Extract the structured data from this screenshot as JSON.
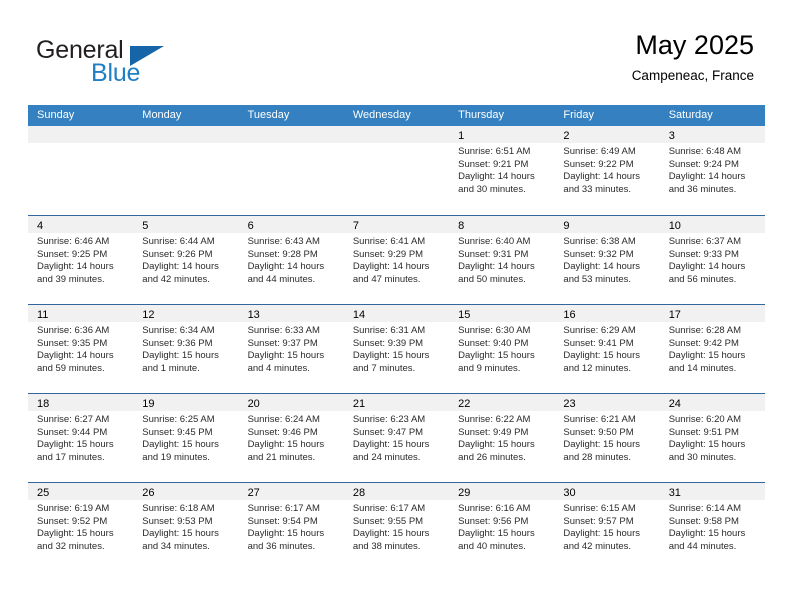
{
  "brand": {
    "name_part1": "General",
    "name_part2": "Blue",
    "accent_color": "#1f7fc4",
    "triangle_color": "#1565a8"
  },
  "header": {
    "title": "May 2025",
    "location": "Campeneac, France"
  },
  "table": {
    "header_bg": "#3480c0",
    "header_text_color": "#ffffff",
    "day_strip_bg": "#f1f1f1",
    "weekdays": [
      "Sunday",
      "Monday",
      "Tuesday",
      "Wednesday",
      "Thursday",
      "Friday",
      "Saturday"
    ]
  },
  "weeks": [
    [
      {
        "day": "",
        "lines": []
      },
      {
        "day": "",
        "lines": []
      },
      {
        "day": "",
        "lines": []
      },
      {
        "day": "",
        "lines": []
      },
      {
        "day": "1",
        "lines": [
          "Sunrise: 6:51 AM",
          "Sunset: 9:21 PM",
          "Daylight: 14 hours",
          "and 30 minutes."
        ]
      },
      {
        "day": "2",
        "lines": [
          "Sunrise: 6:49 AM",
          "Sunset: 9:22 PM",
          "Daylight: 14 hours",
          "and 33 minutes."
        ]
      },
      {
        "day": "3",
        "lines": [
          "Sunrise: 6:48 AM",
          "Sunset: 9:24 PM",
          "Daylight: 14 hours",
          "and 36 minutes."
        ]
      }
    ],
    [
      {
        "day": "4",
        "lines": [
          "Sunrise: 6:46 AM",
          "Sunset: 9:25 PM",
          "Daylight: 14 hours",
          "and 39 minutes."
        ]
      },
      {
        "day": "5",
        "lines": [
          "Sunrise: 6:44 AM",
          "Sunset: 9:26 PM",
          "Daylight: 14 hours",
          "and 42 minutes."
        ]
      },
      {
        "day": "6",
        "lines": [
          "Sunrise: 6:43 AM",
          "Sunset: 9:28 PM",
          "Daylight: 14 hours",
          "and 44 minutes."
        ]
      },
      {
        "day": "7",
        "lines": [
          "Sunrise: 6:41 AM",
          "Sunset: 9:29 PM",
          "Daylight: 14 hours",
          "and 47 minutes."
        ]
      },
      {
        "day": "8",
        "lines": [
          "Sunrise: 6:40 AM",
          "Sunset: 9:31 PM",
          "Daylight: 14 hours",
          "and 50 minutes."
        ]
      },
      {
        "day": "9",
        "lines": [
          "Sunrise: 6:38 AM",
          "Sunset: 9:32 PM",
          "Daylight: 14 hours",
          "and 53 minutes."
        ]
      },
      {
        "day": "10",
        "lines": [
          "Sunrise: 6:37 AM",
          "Sunset: 9:33 PM",
          "Daylight: 14 hours",
          "and 56 minutes."
        ]
      }
    ],
    [
      {
        "day": "11",
        "lines": [
          "Sunrise: 6:36 AM",
          "Sunset: 9:35 PM",
          "Daylight: 14 hours",
          "and 59 minutes."
        ]
      },
      {
        "day": "12",
        "lines": [
          "Sunrise: 6:34 AM",
          "Sunset: 9:36 PM",
          "Daylight: 15 hours",
          "and 1 minute."
        ]
      },
      {
        "day": "13",
        "lines": [
          "Sunrise: 6:33 AM",
          "Sunset: 9:37 PM",
          "Daylight: 15 hours",
          "and 4 minutes."
        ]
      },
      {
        "day": "14",
        "lines": [
          "Sunrise: 6:31 AM",
          "Sunset: 9:39 PM",
          "Daylight: 15 hours",
          "and 7 minutes."
        ]
      },
      {
        "day": "15",
        "lines": [
          "Sunrise: 6:30 AM",
          "Sunset: 9:40 PM",
          "Daylight: 15 hours",
          "and 9 minutes."
        ]
      },
      {
        "day": "16",
        "lines": [
          "Sunrise: 6:29 AM",
          "Sunset: 9:41 PM",
          "Daylight: 15 hours",
          "and 12 minutes."
        ]
      },
      {
        "day": "17",
        "lines": [
          "Sunrise: 6:28 AM",
          "Sunset: 9:42 PM",
          "Daylight: 15 hours",
          "and 14 minutes."
        ]
      }
    ],
    [
      {
        "day": "18",
        "lines": [
          "Sunrise: 6:27 AM",
          "Sunset: 9:44 PM",
          "Daylight: 15 hours",
          "and 17 minutes."
        ]
      },
      {
        "day": "19",
        "lines": [
          "Sunrise: 6:25 AM",
          "Sunset: 9:45 PM",
          "Daylight: 15 hours",
          "and 19 minutes."
        ]
      },
      {
        "day": "20",
        "lines": [
          "Sunrise: 6:24 AM",
          "Sunset: 9:46 PM",
          "Daylight: 15 hours",
          "and 21 minutes."
        ]
      },
      {
        "day": "21",
        "lines": [
          "Sunrise: 6:23 AM",
          "Sunset: 9:47 PM",
          "Daylight: 15 hours",
          "and 24 minutes."
        ]
      },
      {
        "day": "22",
        "lines": [
          "Sunrise: 6:22 AM",
          "Sunset: 9:49 PM",
          "Daylight: 15 hours",
          "and 26 minutes."
        ]
      },
      {
        "day": "23",
        "lines": [
          "Sunrise: 6:21 AM",
          "Sunset: 9:50 PM",
          "Daylight: 15 hours",
          "and 28 minutes."
        ]
      },
      {
        "day": "24",
        "lines": [
          "Sunrise: 6:20 AM",
          "Sunset: 9:51 PM",
          "Daylight: 15 hours",
          "and 30 minutes."
        ]
      }
    ],
    [
      {
        "day": "25",
        "lines": [
          "Sunrise: 6:19 AM",
          "Sunset: 9:52 PM",
          "Daylight: 15 hours",
          "and 32 minutes."
        ]
      },
      {
        "day": "26",
        "lines": [
          "Sunrise: 6:18 AM",
          "Sunset: 9:53 PM",
          "Daylight: 15 hours",
          "and 34 minutes."
        ]
      },
      {
        "day": "27",
        "lines": [
          "Sunrise: 6:17 AM",
          "Sunset: 9:54 PM",
          "Daylight: 15 hours",
          "and 36 minutes."
        ]
      },
      {
        "day": "28",
        "lines": [
          "Sunrise: 6:17 AM",
          "Sunset: 9:55 PM",
          "Daylight: 15 hours",
          "and 38 minutes."
        ]
      },
      {
        "day": "29",
        "lines": [
          "Sunrise: 6:16 AM",
          "Sunset: 9:56 PM",
          "Daylight: 15 hours",
          "and 40 minutes."
        ]
      },
      {
        "day": "30",
        "lines": [
          "Sunrise: 6:15 AM",
          "Sunset: 9:57 PM",
          "Daylight: 15 hours",
          "and 42 minutes."
        ]
      },
      {
        "day": "31",
        "lines": [
          "Sunrise: 6:14 AM",
          "Sunset: 9:58 PM",
          "Daylight: 15 hours",
          "and 44 minutes."
        ]
      }
    ]
  ]
}
